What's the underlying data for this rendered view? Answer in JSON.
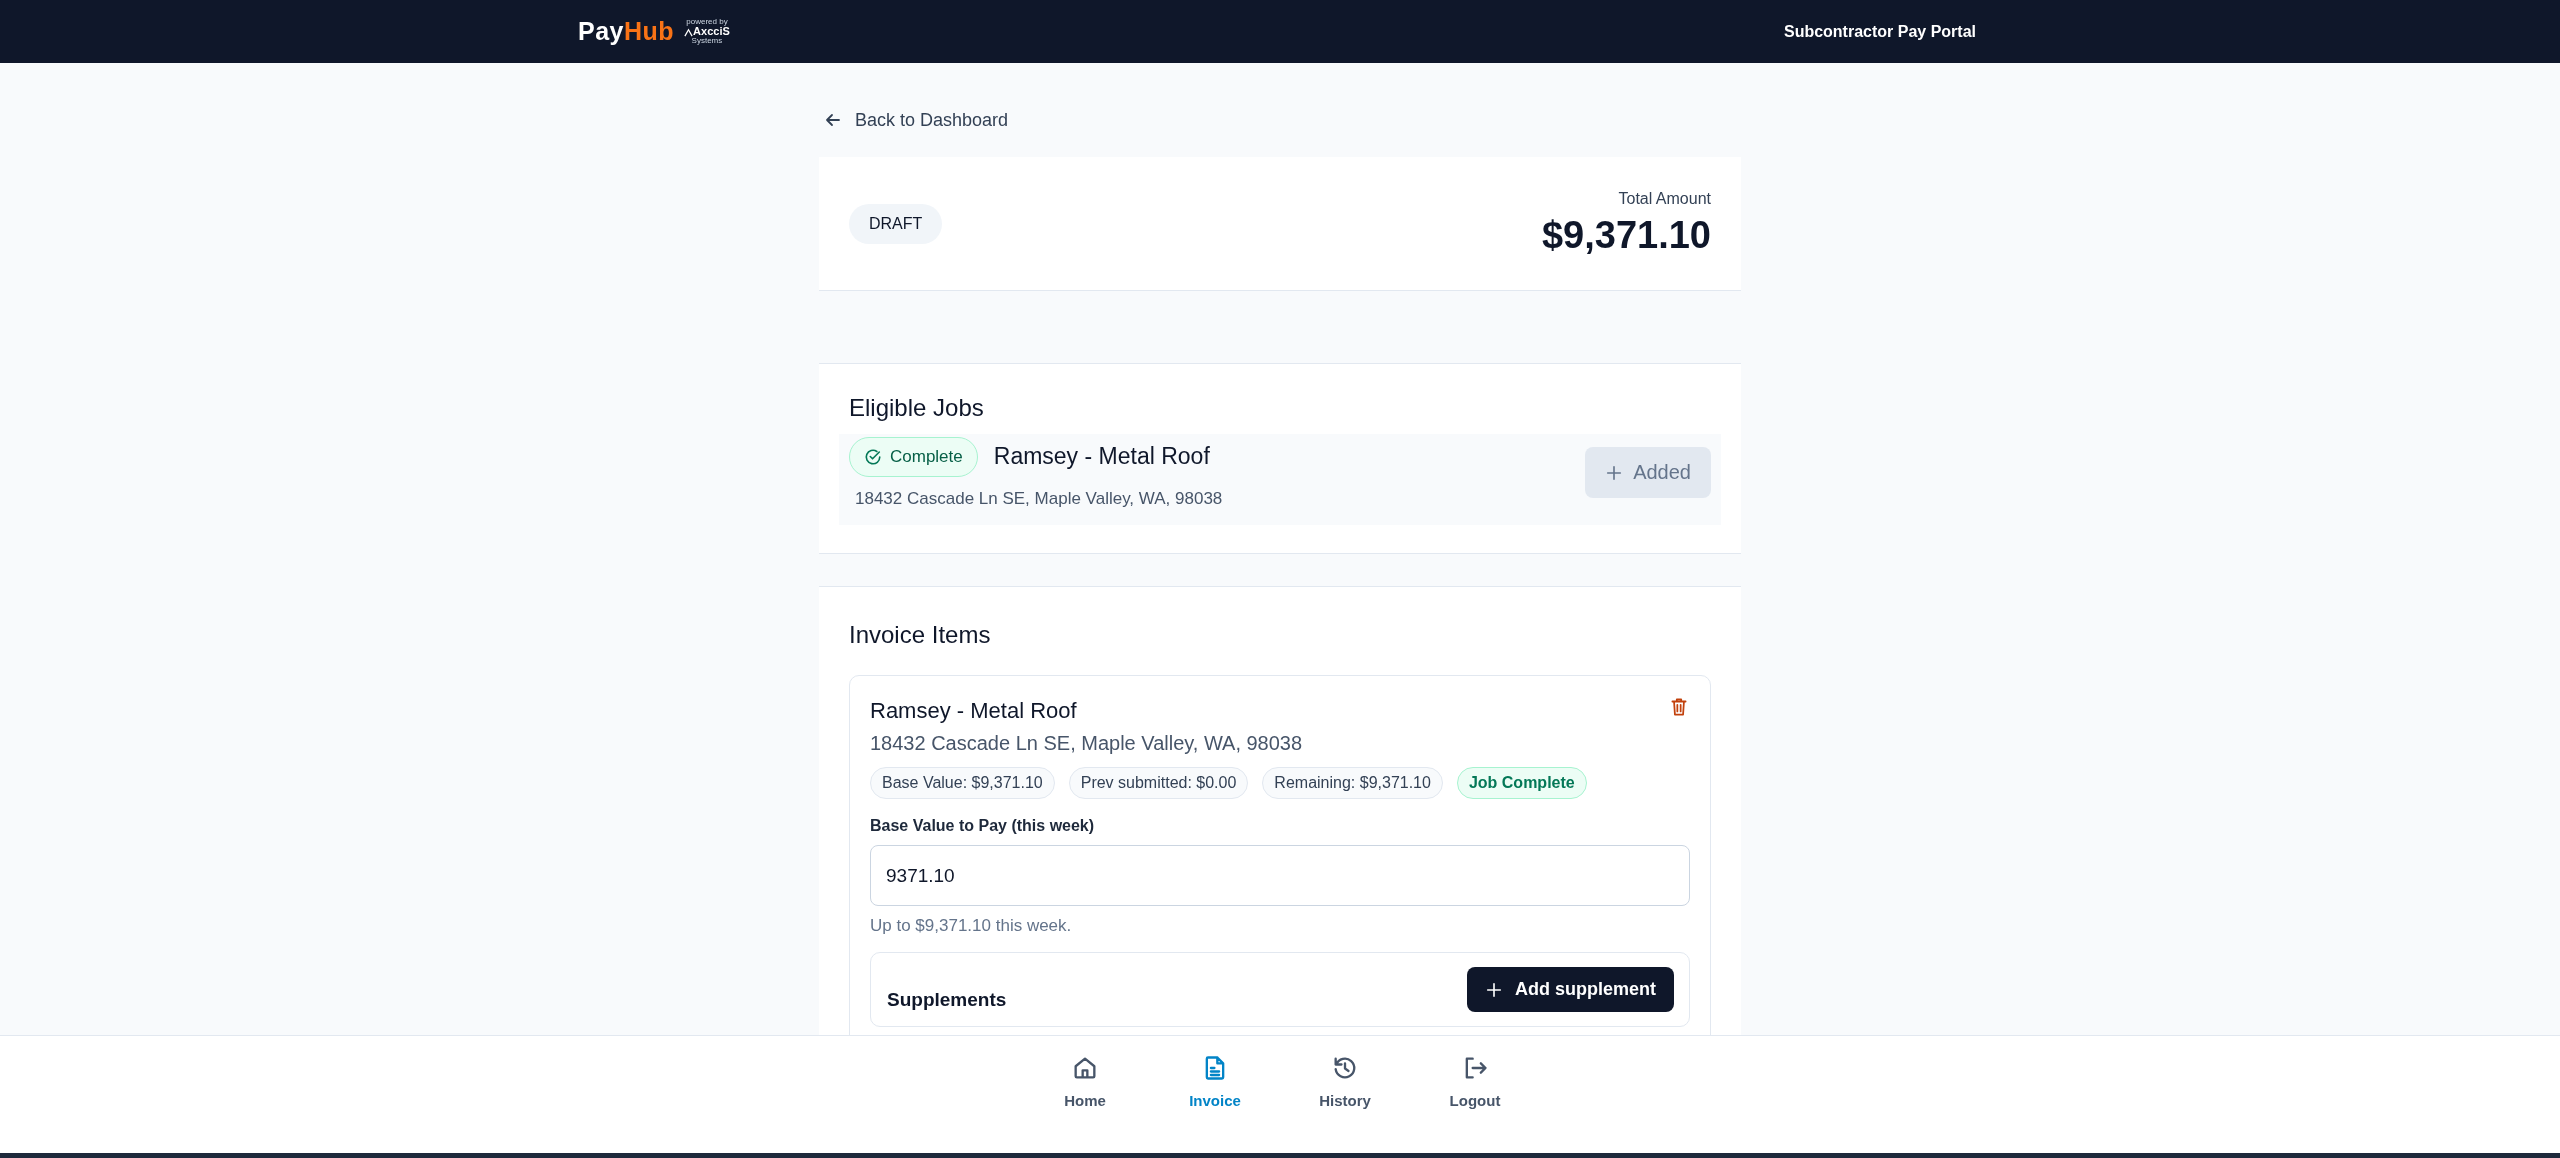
{
  "header": {
    "logo": {
      "first": "Pay",
      "second": "Hub",
      "powered_by": "powered by",
      "partner": "AxcciS",
      "partner_tagline": "Systems"
    },
    "title": "Subcontractor Pay Portal"
  },
  "back_link": "Back to Dashboard",
  "summary": {
    "status": "DRAFT",
    "total_label": "Total Amount",
    "total": "$9,371.10"
  },
  "eligible_jobs": {
    "title": "Eligible Jobs",
    "jobs": [
      {
        "status": "Complete",
        "name": "Ramsey - Metal Roof",
        "address": "18432 Cascade Ln SE, Maple Valley, WA, 98038",
        "action": "Added",
        "added": true
      }
    ]
  },
  "invoice_items": {
    "title": "Invoice Items",
    "items": [
      {
        "name": "Ramsey - Metal Roof",
        "address": "18432 Cascade Ln SE, Maple Valley, WA, 98038",
        "chips": [
          {
            "text": "Base Value: $9,371.10",
            "kind": "neutral"
          },
          {
            "text": "Prev submitted: $0.00",
            "kind": "neutral"
          },
          {
            "text": "Remaining: $9,371.10",
            "kind": "neutral"
          },
          {
            "text": "Job Complete",
            "kind": "success"
          }
        ],
        "field_label": "Base Value to Pay (this week)",
        "value": "9371.10",
        "hint": "Up to $9,371.10 this week.",
        "supplements": {
          "title": "Supplements",
          "button": "Add supplement"
        }
      }
    ]
  },
  "nav": [
    {
      "label": "Home",
      "selected": false
    },
    {
      "label": "Invoice",
      "selected": true
    },
    {
      "label": "History",
      "selected": false
    },
    {
      "label": "Logout",
      "selected": false
    }
  ]
}
